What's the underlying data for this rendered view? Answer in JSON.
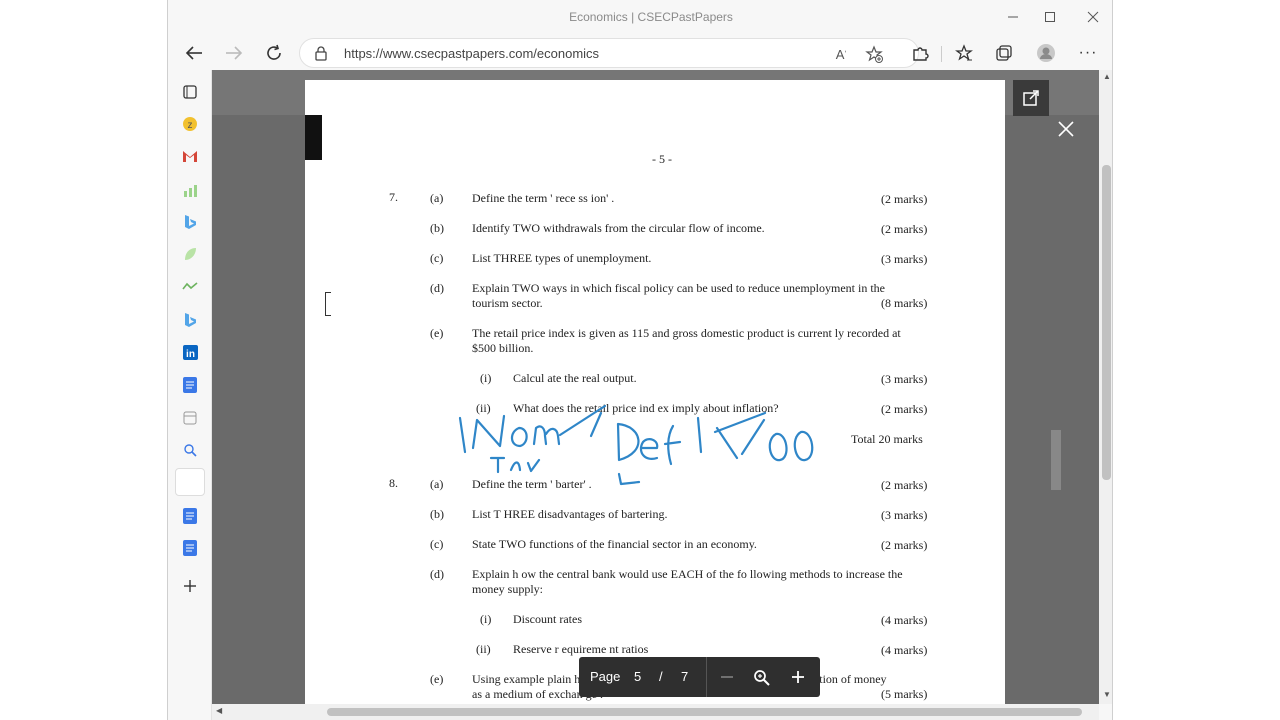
{
  "window": {
    "title": "Economics | CSECPastPapers",
    "minimize_icon": "minimize-icon",
    "maximize_icon": "maximize-icon",
    "close_icon": "close-icon"
  },
  "toolbar": {
    "url": "https://www.csecpastpapers.com/economics"
  },
  "sidebar": {
    "icons": [
      "tabs-icon",
      "zotero-icon",
      "gmail-icon",
      "chart-icon",
      "bing-icon",
      "leaf-icon",
      "signal-icon",
      "bing-icon",
      "linkedin-icon",
      "docs-icon",
      "calendar-icon",
      "search-icon",
      "blank-icon",
      "docs-icon",
      "docs-icon",
      "add-icon"
    ]
  },
  "document": {
    "page_header": "- 5 -",
    "q7": {
      "number": "7.",
      "a_label": "(a)",
      "a_text": "Define  the  term ' rece ss ion' .",
      "a_marks": "(2 marks)",
      "b_label": "(b)",
      "b_text": "Identify  TWO  withdrawals from the circular flow      of income.",
      "b_marks": "(2 marks)",
      "c_label": "(c)",
      "c_text": "List THREE  types  of unemployment.",
      "c_marks": "(3 marks)",
      "d_label": "(d)",
      "d_text1": "Explain  TWO  ways  in  which fiscal  policy can    be  used to  reduce   unemployment    in the",
      "d_text2": "tourism sector.",
      "d_marks": "(8 marks)",
      "e_label": "(e)",
      "e_text1": "The  retail price index is given     as  115 and gross domestic product is      current ly recorded   at",
      "e_text2": "$500  billion.",
      "ei_label": "(i)",
      "ei_text": "Calcul ate  the real  output.",
      "ei_marks": "(3 marks)",
      "eii_label": "(ii)",
      "eii_text": "What  does  the retail price ind   ex  imply  about  inflation?",
      "eii_marks": "(2 marks)",
      "total": "Total  20 marks"
    },
    "q8": {
      "number": "8.",
      "a_label": "(a)",
      "a_text": "Define  the  term ' barter' .",
      "a_marks": "(2 marks)",
      "b_label": "(b)",
      "b_text": "List T HREE disadvantages     of bartering.",
      "b_marks": "(3 marks)",
      "c_label": "(c)",
      "c_text": "State  TWO  functions   of the financial  sector    in an economy.",
      "c_marks": "(2 marks)",
      "d_label": "(d)",
      "d_text1": "Explain h ow  the central   bank  would use   EACH  of the fo llowing  methods to  increase the",
      "d_text2": "money  supply:",
      "di_label": "(i)",
      "di_text": "Discount rates",
      "di_marks": "(4 marks)",
      "dii_label": "(ii)",
      "dii_text": "Reserve r equireme nt ratios",
      "dii_marks": "(4 marks)",
      "e_label": "(e)",
      "e_text1": "Using example    plain how the use    of credit cards h as impr    oved  the function   of money",
      "e_text2": "as a medium    of exchan ge .",
      "e_marks": "(5 marks)"
    }
  },
  "pagebar": {
    "page_label": "Page",
    "current_page": "5",
    "separator": "/",
    "total_pages": "7"
  },
  "colors": {
    "ink": "#2f86c8",
    "viewer_bg": "#6a6a6a",
    "toolbar_bg": "#2f2f2f"
  }
}
